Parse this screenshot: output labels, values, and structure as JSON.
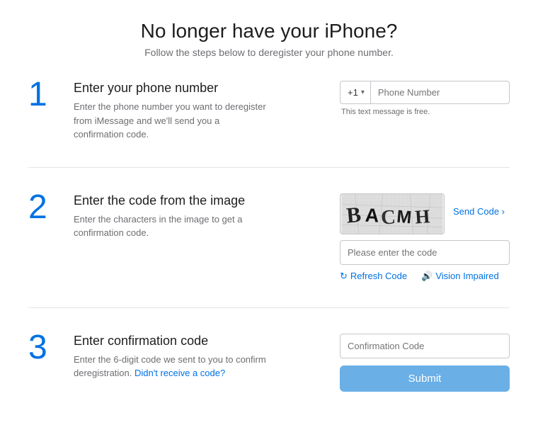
{
  "page": {
    "title": "No longer have your iPhone?",
    "subtitle": "Follow the steps below to deregister your phone number."
  },
  "steps": [
    {
      "number": "1",
      "title": "Enter your phone number",
      "description": "Enter the phone number you want to deregister from iMessage and we'll send you a confirmation code.",
      "input": {
        "country_code": "+1",
        "placeholder": "Phone Number",
        "free_text": "This text message is free."
      }
    },
    {
      "number": "2",
      "title": "Enter the code from the image",
      "description": "Enter the characters in the image to get a confirmation code.",
      "captcha_text": "BACMH",
      "send_code_label": "Send Code",
      "code_placeholder": "Please enter the code",
      "refresh_label": "Refresh Code",
      "vision_label": "Vision Impaired"
    },
    {
      "number": "3",
      "title": "Enter confirmation code",
      "description": "Enter the 6-digit code we sent to you to confirm deregistration.",
      "link_text": "Didn't receive a code?",
      "input_placeholder": "Confirmation Code",
      "submit_label": "Submit"
    }
  ]
}
